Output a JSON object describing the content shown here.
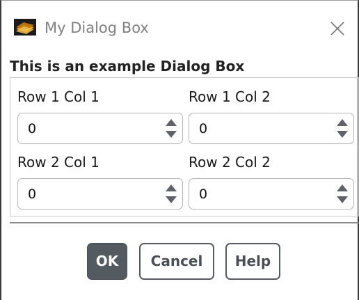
{
  "window": {
    "title": "My Dialog Box",
    "icon": "app-logo-icon",
    "close_icon": "close-icon"
  },
  "dialog": {
    "heading": "This is an example Dialog Box",
    "fields": [
      {
        "label": "Row 1 Col 1",
        "value": "0"
      },
      {
        "label": "Row 1 Col 2",
        "value": "0"
      },
      {
        "label": "Row 2 Col 1",
        "value": "0"
      },
      {
        "label": "Row 2 Col 2",
        "value": "0"
      }
    ]
  },
  "buttons": {
    "ok": "OK",
    "cancel": "Cancel",
    "help": "Help"
  },
  "colors": {
    "primary_button": "#535a60",
    "button_border": "#555a60",
    "title_text": "#808080"
  }
}
